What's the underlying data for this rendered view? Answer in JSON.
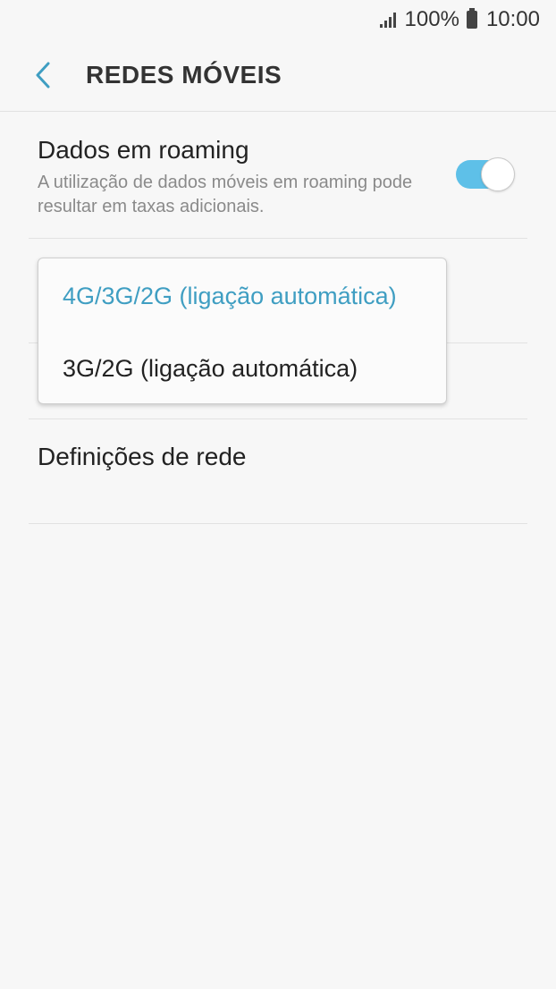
{
  "status_bar": {
    "battery": "100%",
    "time": "10:00",
    "signal_icon": "signal-icon",
    "battery_icon": "battery-icon"
  },
  "header": {
    "title": "REDES MÓVEIS",
    "back_icon": "chevron-left-icon"
  },
  "settings": {
    "roaming": {
      "title": "Dados em roaming",
      "summary": "A utilização de dados móveis em roaming pode resultar em taxas adicionais.",
      "enabled": true
    },
    "network_settings": {
      "title": "Definições de rede"
    }
  },
  "network_mode_dropdown": {
    "options": [
      {
        "label": "4G/3G/2G (ligação automática)",
        "selected": true
      },
      {
        "label": "3G/2G (ligação automática)",
        "selected": false
      }
    ]
  },
  "colors": {
    "accent": "#3f9ec2",
    "toggle_on": "#5ec0e8",
    "background": "#f7f7f7"
  }
}
